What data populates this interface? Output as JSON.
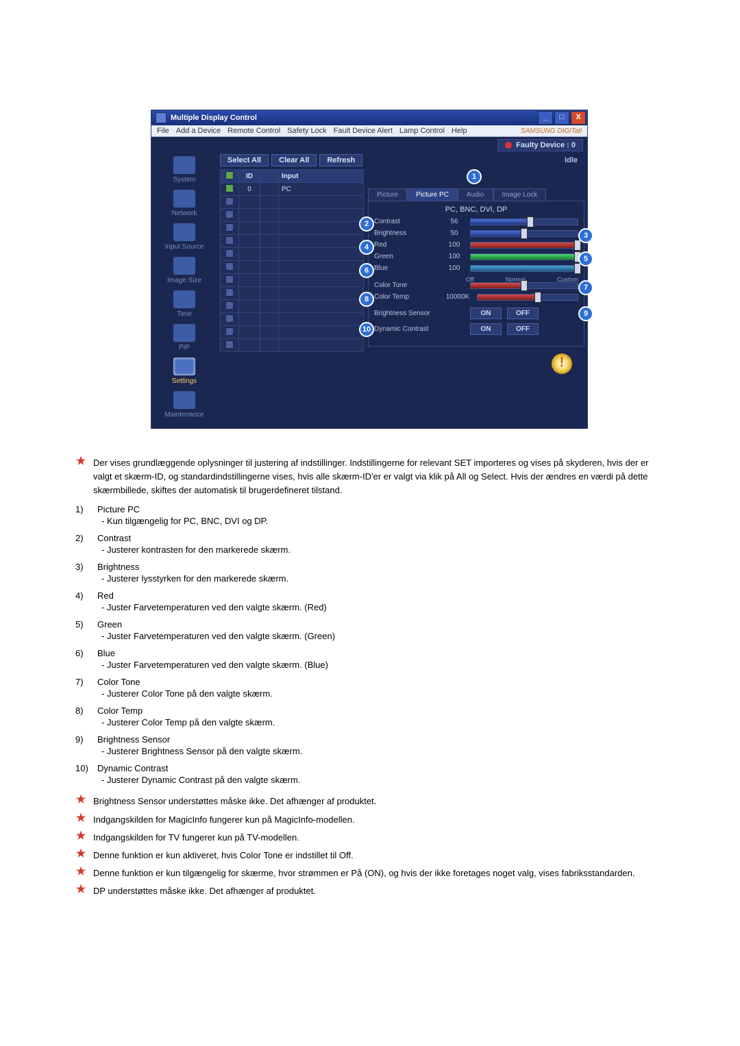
{
  "app": {
    "title": "Multiple Display Control",
    "brand": "SAMSUNG DIGITall",
    "menubar": [
      "File",
      "Add a Device",
      "Remote Control",
      "Safety Lock",
      "Fault Device Alert",
      "Lamp Control",
      "Help"
    ],
    "faulty_label": "Faulty Device : 0",
    "actions": {
      "select_all": "Select All",
      "clear_all": "Clear All",
      "refresh": "Refresh"
    },
    "idle": "Idle",
    "sidebar": [
      {
        "label": "System"
      },
      {
        "label": "Network"
      },
      {
        "label": "Input Source"
      },
      {
        "label": "Image Size"
      },
      {
        "label": "Time"
      },
      {
        "label": "PIP"
      },
      {
        "label": "Settings"
      },
      {
        "label": "Maintenance"
      }
    ],
    "grid": {
      "headers": [
        "",
        "ID",
        "",
        "Input"
      ],
      "row": {
        "id": "0",
        "input": "PC"
      }
    },
    "tabs": [
      "Picture",
      "Picture PC",
      "Audio",
      "Image Lock"
    ],
    "panel_header": "PC, BNC, DVI, DP",
    "sliders": {
      "contrast": {
        "label": "Contrast",
        "value": "56",
        "pct": 56
      },
      "brightness": {
        "label": "Brightness",
        "value": "50",
        "pct": 50
      },
      "red": {
        "label": "Red",
        "value": "100",
        "pct": 100
      },
      "green": {
        "label": "Green",
        "value": "100",
        "pct": 100
      },
      "blue": {
        "label": "Blue",
        "value": "100",
        "pct": 100
      },
      "color_tone": {
        "label": "Color Tone",
        "labels": [
          "Off",
          "Normal",
          "Custom"
        ],
        "pct": 50
      },
      "color_temp": {
        "label": "Color Temp",
        "value": "10000K",
        "pct": 60
      }
    },
    "toggles": {
      "brightness_sensor": {
        "label": "Brightness Sensor",
        "on": "ON",
        "off": "OFF"
      },
      "dynamic_contrast": {
        "label": "Dynamic Contrast",
        "on": "ON",
        "off": "OFF"
      }
    }
  },
  "callouts": [
    "1",
    "2",
    "3",
    "4",
    "5",
    "6",
    "7",
    "8",
    "9",
    "10"
  ],
  "desc": {
    "intro": "Der vises grundlæggende oplysninger til justering af indstillinger. Indstillingerne for relevant SET importeres og vises på skyderen, hvis der er valgt et skærm-ID, og standardindstillingerne vises, hvis alle skærm-ID'er er valgt via klik på All og Select. Hvis der ændres en værdi på dette skærmbillede, skiftes der automatisk til brugerdefineret tilstand.",
    "items": [
      {
        "num": "1)",
        "title": "Picture PC",
        "sub": "Kun tilgængelig for PC, BNC, DVI og DP."
      },
      {
        "num": "2)",
        "title": "Contrast",
        "sub": "Justerer kontrasten for den markerede skærm."
      },
      {
        "num": "3)",
        "title": "Brightness",
        "sub": "Justerer lysstyrken for den markerede skærm."
      },
      {
        "num": "4)",
        "title": "Red",
        "sub": "Juster Farvetemperaturen ved den valgte skærm. (Red)"
      },
      {
        "num": "5)",
        "title": "Green",
        "sub": "Juster Farvetemperaturen ved den valgte skærm. (Green)"
      },
      {
        "num": "6)",
        "title": "Blue",
        "sub": "Juster Farvetemperaturen ved den valgte skærm. (Blue)"
      },
      {
        "num": "7)",
        "title": "Color Tone",
        "sub": "Justerer Color Tone på den valgte skærm."
      },
      {
        "num": "8)",
        "title": "Color Temp",
        "sub": "Justerer Color Temp på den valgte skærm."
      },
      {
        "num": "9)",
        "title": "Brightness Sensor",
        "sub": "Justerer Brightness Sensor på den valgte skærm."
      },
      {
        "num": "10)",
        "title": "Dynamic Contrast",
        "sub": "Justerer Dynamic Contrast på den valgte skærm."
      }
    ],
    "notes": [
      "Brightness Sensor understøttes måske ikke. Det afhænger af produktet.",
      "Indgangskilden for MagicInfo fungerer kun på MagicInfo-modellen.",
      "Indgangskilden for TV fungerer kun på TV-modellen.",
      "Denne funktion er kun aktiveret, hvis Color Tone er indstillet til Off.",
      "Denne funktion er kun tilgængelig for skærme, hvor strømmen er På (ON), og hvis der ikke foretages noget valg, vises fabriksstandarden.",
      "DP understøttes måske ikke. Det afhænger af produktet."
    ]
  }
}
